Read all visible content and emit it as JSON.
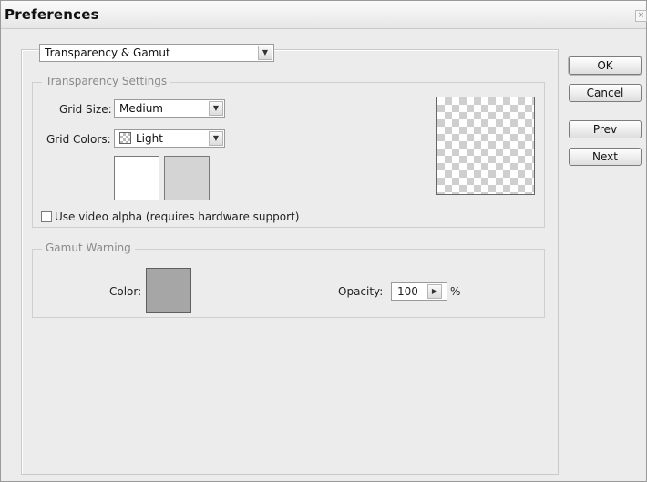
{
  "window": {
    "title": "Preferences"
  },
  "section_select": {
    "value": "Transparency & Gamut"
  },
  "transparency": {
    "group_title": "Transparency Settings",
    "grid_size_label": "Grid Size:",
    "grid_size_value": "Medium",
    "grid_colors_label": "Grid Colors:",
    "grid_colors_value": "Light",
    "grid_colors_icon": "checker-icon",
    "swatch_1_color": "#ffffff",
    "swatch_2_color": "#d4d4d4",
    "video_alpha_label": "Use video alpha (requires hardware support)",
    "video_alpha_checked": false
  },
  "gamut": {
    "group_title": "Gamut Warning",
    "color_label": "Color:",
    "color_value": "#a6a6a6",
    "opacity_label": "Opacity:",
    "opacity_value": "100",
    "opacity_unit": "%"
  },
  "buttons": {
    "ok": "OK",
    "cancel": "Cancel",
    "prev": "Prev",
    "next": "Next"
  }
}
